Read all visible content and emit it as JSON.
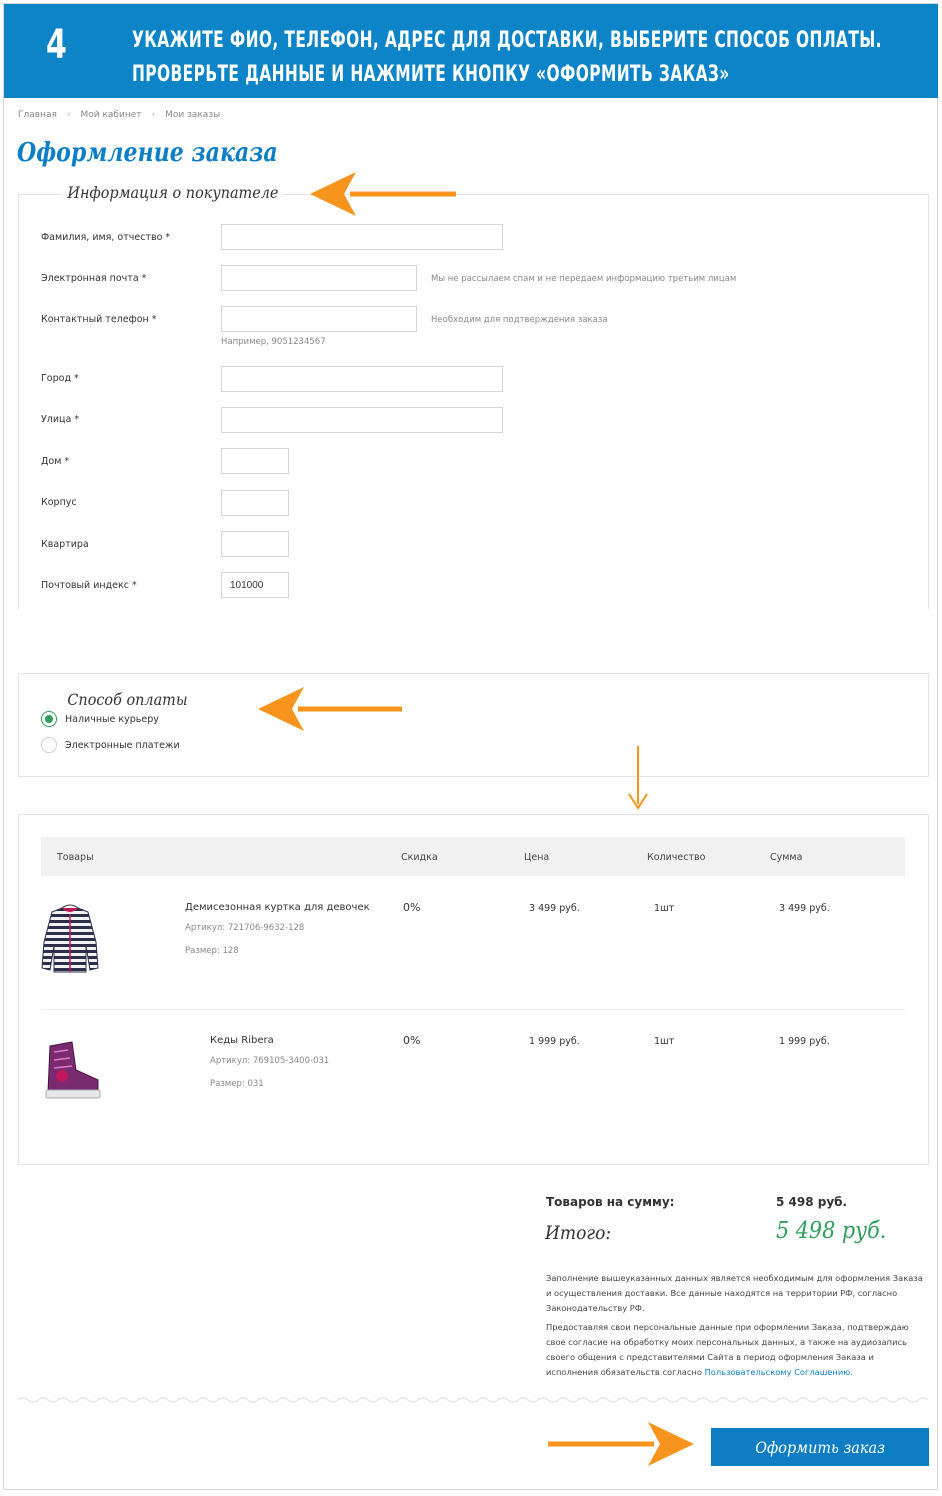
{
  "banner": {
    "step": "4",
    "line1": "УКАЖИТЕ ФИО, ТЕЛЕФОН, АДРЕС ДЛЯ ДОСТАВКИ, ВЫБЕРИТЕ СПОСОБ ОПЛАТЫ.",
    "line2": "ПРОВЕРЬТЕ ДАННЫЕ И НАЖМИТЕ КНОПКУ «ОФОРМИТЬ ЗАКАЗ»"
  },
  "breadcrumb": [
    "Главная",
    "Мой кабинет",
    "Мои заказы"
  ],
  "page_title": "Оформление заказа",
  "buyer": {
    "legend": "Информация о покупателе",
    "fields": {
      "fio": {
        "label": "Фамилия, имя, отчество *",
        "value": ""
      },
      "email": {
        "label": "Электронная почта *",
        "value": "",
        "hint": "Мы не рассылаем спам и не передаем информацию третьим лицам"
      },
      "phone": {
        "label": "Контактный телефон *",
        "value": "",
        "hint": "Необходим для подтверждения заказа",
        "example": "Например, 9051234567"
      },
      "city": {
        "label": "Город *",
        "value": ""
      },
      "street": {
        "label": "Улица *",
        "value": ""
      },
      "house": {
        "label": "Дом *",
        "value": ""
      },
      "building": {
        "label": "Корпус",
        "value": ""
      },
      "flat": {
        "label": "Квартира",
        "value": ""
      },
      "zip": {
        "label": "Почтовый индекс *",
        "value": "101000"
      }
    }
  },
  "payment": {
    "legend": "Способ оплаты",
    "options": [
      {
        "label": "Наличные курьеру",
        "selected": true
      },
      {
        "label": "Электронные платежи",
        "selected": false
      }
    ]
  },
  "table": {
    "headers": [
      "Товары",
      "Скидка",
      "Цена",
      "Количество",
      "Сумма"
    ],
    "rows": [
      {
        "name": "Демисезонная куртка для девочек",
        "sku": "Артикул: 721706-9632-128",
        "size": "Размер: 128",
        "discount": "0%",
        "price": "3 499 руб.",
        "qty": "1шт",
        "sum": "3 499 руб.",
        "thumb_icon": "striped-jacket-icon"
      },
      {
        "name": "Кеды Ribera",
        "sku": "Артикул: 769105-3400-031",
        "size": "Размер: 031",
        "discount": "0%",
        "price": "1 999 руб.",
        "qty": "1шт",
        "sum": "1 999 руб.",
        "thumb_icon": "purple-sneaker-icon"
      }
    ]
  },
  "totals": {
    "items_label": "Товаров на сумму:",
    "items_value": "5 498 руб.",
    "grand_label": "Итого:",
    "grand_value": "5 498 руб."
  },
  "notes": {
    "p1": "Заполнение вышеуказанных данных является необходимым для оформления Заказа и осуществления доставки. Все данные находятся на территории РФ, согласно Законодательству РФ.",
    "p2": "Предоставляя свои персональные данные при оформлении Заказа, подтверждаю свое согласие на обработку моих персональных данных, а также на аудиозапись своего общения с представителями Сайта в период оформления Заказа и исполнения обязательств согласно",
    "link": "Пользовательскому Соглашению."
  },
  "submit_label": "Оформить заказ",
  "colors": {
    "banner": "#0d84c8",
    "accent": "#0e7fc4",
    "arrow": "#f7941d",
    "total_green": "#2f9e5a"
  }
}
